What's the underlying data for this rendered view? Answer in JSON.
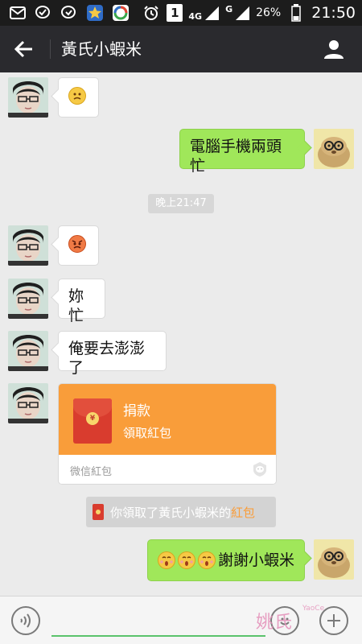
{
  "status_bar": {
    "notification_badge": "1",
    "network_4g": "4G",
    "network_g": "G",
    "battery_percent": "26%",
    "time": "21:50"
  },
  "header": {
    "title": "黃氏小蝦米"
  },
  "messages": {
    "m2_text": "電腦手機兩頭忙",
    "time_separator": "晚上21:47",
    "m4_text": "妳忙",
    "m5_text": "俺要去澎澎了",
    "red_packet": {
      "title": "捐款",
      "subtitle": "領取紅包",
      "brand": "微信紅包",
      "coin": "¥"
    },
    "system_notice": {
      "prefix": "你領取了黃氏小蝦米的",
      "highlight": "紅包"
    },
    "m8_text": "謝謝小蝦米"
  },
  "input_bar": {
    "text_value": "",
    "watermark": "姚氏",
    "watermark_sub": "YaoCe"
  }
}
